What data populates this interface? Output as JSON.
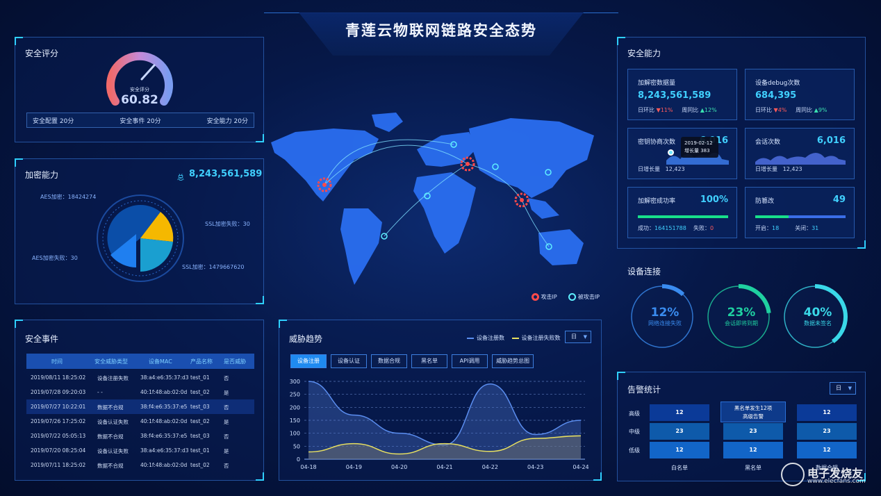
{
  "header": {
    "title": "青莲云物联网链路安全态势"
  },
  "security_score": {
    "title": "安全评分",
    "gauge_label": "安全评分",
    "score": "60.82",
    "score_fraction": 0.6082,
    "items": [
      "安全配置  20分",
      "安全事件  20分",
      "安全能力  20分"
    ]
  },
  "encryption": {
    "title": "加密能力",
    "total_prefix": "总",
    "total": "8,243,561,589",
    "labels": {
      "aes": "AES加密：18424274",
      "ssl_fail": "SSL加密失败：30",
      "aes_fail": "AES加密失败：30",
      "ssl": "SSL加密：1479667620"
    },
    "colors": [
      "#0b4ea8",
      "#f5b800",
      "#1a9fd0",
      "#1f7ff0"
    ]
  },
  "map": {
    "legend_attack": "攻击IP",
    "legend_attacked": "被攻击IP",
    "tooltip_date": "2019-02-12",
    "tooltip_value": "增长量  383"
  },
  "events": {
    "title": "安全事件",
    "headers": [
      "时间",
      "安全威胁类型",
      "设备MAC",
      "产品名称",
      "是否威胁"
    ],
    "rows": [
      [
        "2019/08/11  18:25:02",
        "设备注册失败",
        "38:a4:e6:35:37:d3",
        "test_01",
        "否"
      ],
      [
        "2019/07/28  09:20:03",
        "- -",
        "40:1f:48:ab:02:0d",
        "test_02",
        "是"
      ],
      [
        "2019/07/27  10:22:01",
        "数据不合规",
        "38:f4:e6:35:37:e5",
        "test_03",
        "否"
      ],
      [
        "2019/07/26  17:25:02",
        "设备认证失败",
        "40:1f:48:ab:02:0d",
        "test_02",
        "是"
      ],
      [
        "2019/07/22  05:05:13",
        "数据不合规",
        "38:f4:e6:35:37:e5",
        "test_03",
        "否"
      ],
      [
        "2019/07/20  08:25:04",
        "设备认证失败",
        "38:a4:e6:35:37:d3",
        "test_01",
        "是"
      ],
      [
        "2019/07/11  18:25:02",
        "数据不合规",
        "40:1f:48:ab:02:0d",
        "test_02",
        "否"
      ]
    ]
  },
  "threat": {
    "title": "威胁趋势",
    "legend": [
      "设备注册数",
      "设备注册失败数"
    ],
    "dropdown": "日",
    "tabs": [
      "设备注册",
      "设备认证",
      "数据合规",
      "黑名单",
      "API调用",
      "威胁趋势总图"
    ]
  },
  "chart_data": {
    "type": "area",
    "x": [
      "04-18",
      "04-19",
      "04-20",
      "04-21",
      "04-22",
      "04-23",
      "04-24"
    ],
    "ylim": [
      0,
      300
    ],
    "yticks": [
      0,
      50,
      100,
      150,
      200,
      250,
      300
    ],
    "series": [
      {
        "name": "设备注册数",
        "color": "#5b8ef0",
        "values": [
          300,
          170,
          100,
          55,
          290,
          95,
          150
        ]
      },
      {
        "name": "设备注册失败数",
        "color": "#e8e060",
        "values": [
          28,
          60,
          20,
          60,
          30,
          80,
          90
        ]
      }
    ]
  },
  "capability": {
    "title": "安全能力",
    "cards": [
      {
        "label": "加解密数据量",
        "value": "8,243,561,589",
        "dod_label": "日环比",
        "dod": "11%",
        "dod_dir": "down",
        "yoy_label": "周同比",
        "yoy": "12%",
        "yoy_dir": "up"
      },
      {
        "label": "设备debug次数",
        "value": "684,395",
        "dod_label": "日环比",
        "dod": "4%",
        "dod_dir": "down",
        "yoy_label": "周同比",
        "yoy": "9%",
        "yoy_dir": "up"
      },
      {
        "label": "密钥协商次数",
        "value": "6,016",
        "growth_label": "日增长量",
        "growth": "12,423"
      },
      {
        "label": "会话次数",
        "value": "6,016",
        "growth_label": "日增长量",
        "growth": "12,423"
      },
      {
        "label": "加解密成功率",
        "value": "100%",
        "success_label": "成功：",
        "success": "164151788",
        "fail_label": "失败：",
        "fail": "0",
        "bar_fraction": 1.0
      },
      {
        "label": "防篡改",
        "value": "49",
        "on_label": "开启：",
        "on": "18",
        "off_label": "关闭：",
        "off": "31",
        "bar_fraction": 0.37
      }
    ]
  },
  "devices": {
    "title": "设备连接",
    "rings": [
      {
        "pct": "12%",
        "value": 0.12,
        "label": "网络连接失败",
        "color": "#3a8cf0"
      },
      {
        "pct": "23%",
        "value": 0.23,
        "label": "会话即将到期",
        "color": "#1fd0a0"
      },
      {
        "pct": "40%",
        "value": 0.4,
        "label": "数据未签名",
        "color": "#3ad8e8"
      }
    ]
  },
  "alerts": {
    "title": "告警统计",
    "dropdown": "日",
    "levels": [
      "高级",
      "中级",
      "低级"
    ],
    "columns": [
      "白名单",
      "黑名单",
      "数据合规"
    ],
    "values": [
      [
        12,
        12,
        12
      ],
      [
        23,
        23,
        23
      ],
      [
        12,
        12,
        12
      ]
    ],
    "tooltip": [
      "黑名单发生12项",
      "高级告警"
    ]
  },
  "watermark": {
    "text": "电子发烧友",
    "url": "www.elecfans.com"
  }
}
